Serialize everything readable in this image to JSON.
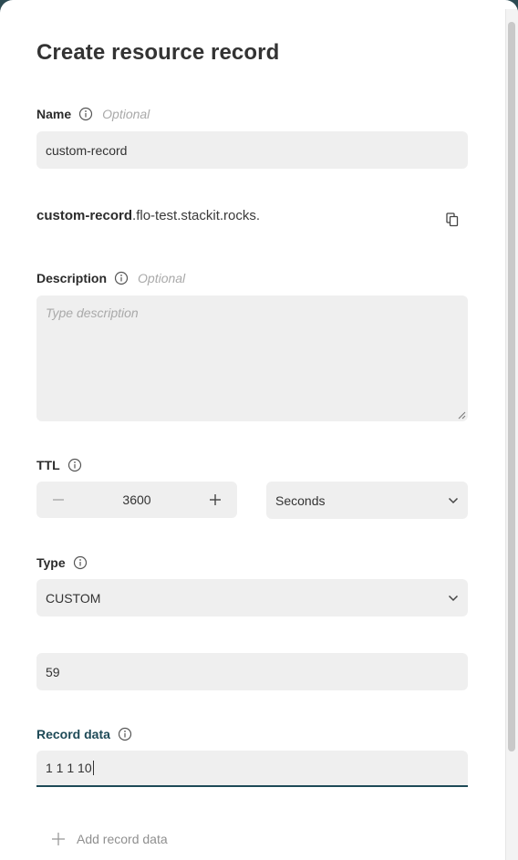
{
  "dialog": {
    "title": "Create resource record"
  },
  "name": {
    "label": "Name",
    "optional": "Optional",
    "value": "custom-record"
  },
  "fqdn": {
    "record_part": "custom-record",
    "zone_part": ".flo-test.stackit.rocks."
  },
  "description": {
    "label": "Description",
    "optional": "Optional",
    "placeholder": "Type description"
  },
  "ttl": {
    "label": "TTL",
    "value": "3600",
    "unit": "Seconds"
  },
  "type": {
    "label": "Type",
    "value": "CUSTOM"
  },
  "custom_type_number": {
    "value": "59"
  },
  "record_data": {
    "label": "Record data",
    "value": "1 1 1 10"
  },
  "actions": {
    "add_record_data": "Add record data"
  },
  "colors": {
    "accent": "#1e4a57",
    "field_bg": "#efefef",
    "placeholder": "#a9a9a9"
  }
}
